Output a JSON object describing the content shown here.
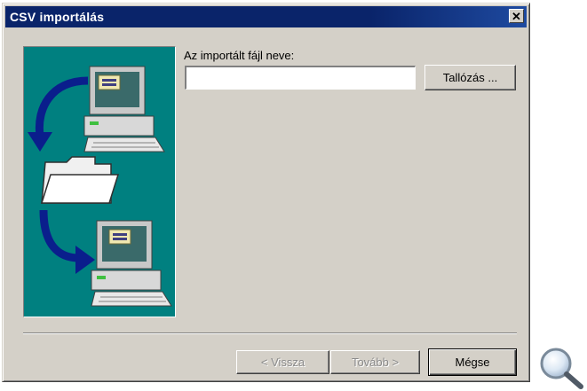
{
  "window": {
    "title": "CSV importálás",
    "close_glyph": "✕"
  },
  "form": {
    "file_label": "Az importált fájl neve:",
    "file_value": "",
    "browse_label": "Tallózás ..."
  },
  "footer": {
    "back_label": "< Vissza",
    "next_label": "Tovább >",
    "cancel_label": "Mégse"
  },
  "illustration": {
    "icons": [
      "computer-icon",
      "arrow-icon",
      "folder-icon",
      "computer-icon"
    ]
  },
  "colors": {
    "title_bar": "#0a246a",
    "dialog_bg": "#d4d0c8",
    "illustration_bg": "#008080",
    "arrow": "#0a1e8c"
  },
  "overlay": {
    "icon": "magnifier-icon"
  }
}
